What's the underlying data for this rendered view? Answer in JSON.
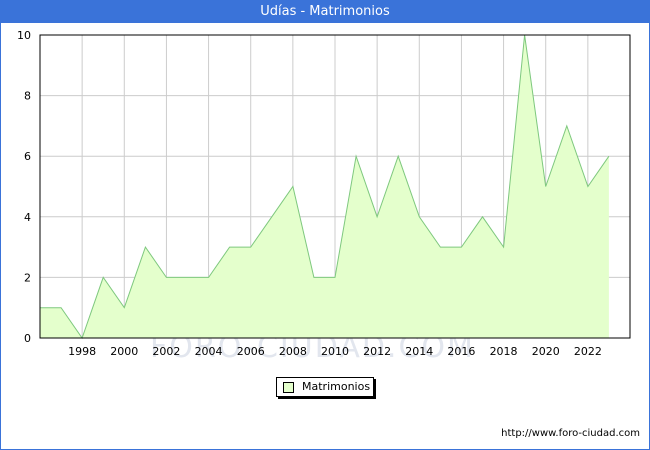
{
  "header": {
    "title": "Udías - Matrimonios"
  },
  "watermark": "FORO-CIUDAD.COM",
  "source": "http://www.foro-ciudad.com",
  "colors": {
    "title_bg": "#3a73d9",
    "area_fill": "#e4ffcc",
    "line": "#7ec87e",
    "grid": "#cccccc"
  },
  "chart_data": {
    "type": "area",
    "title": "Udías - Matrimonios",
    "xlabel": "",
    "ylabel": "",
    "xlim": [
      1996,
      2024
    ],
    "ylim": [
      0,
      10
    ],
    "x_ticks": [
      1998,
      2000,
      2002,
      2004,
      2006,
      2008,
      2010,
      2012,
      2014,
      2016,
      2018,
      2020,
      2022
    ],
    "y_ticks": [
      0,
      2,
      4,
      6,
      8,
      10
    ],
    "grid": true,
    "legend_position": "bottom-center",
    "x": [
      1996,
      1997,
      1998,
      1999,
      2000,
      2001,
      2002,
      2003,
      2004,
      2005,
      2006,
      2007,
      2008,
      2009,
      2010,
      2011,
      2012,
      2013,
      2014,
      2015,
      2016,
      2017,
      2018,
      2019,
      2020,
      2021,
      2022,
      2023
    ],
    "series": [
      {
        "name": "Matrimonios",
        "values": [
          1,
          1,
          0,
          2,
          1,
          3,
          2,
          2,
          2,
          3,
          3,
          4,
          5,
          2,
          2,
          6,
          4,
          6,
          4,
          3,
          3,
          4,
          3,
          10,
          5,
          7,
          5,
          6
        ]
      }
    ]
  }
}
